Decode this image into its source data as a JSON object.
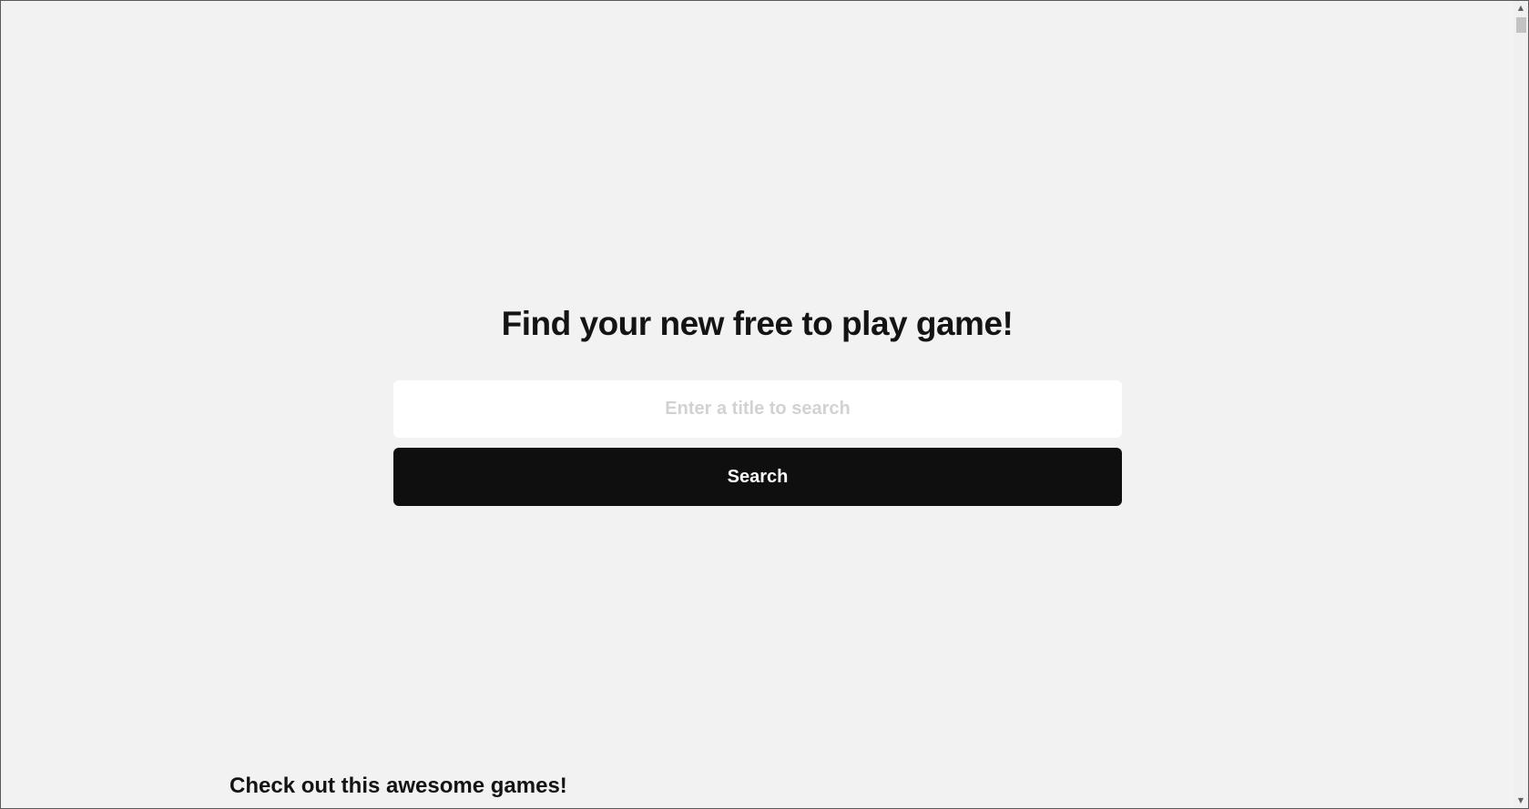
{
  "hero": {
    "title": "Find your new free to play game!"
  },
  "search": {
    "placeholder": "Enter a title to search",
    "value": "",
    "button_label": "Search"
  },
  "featured": {
    "title": "Check out this awesome games!"
  },
  "scrollbar": {
    "up_arrow": "▲",
    "down_arrow": "▼"
  }
}
